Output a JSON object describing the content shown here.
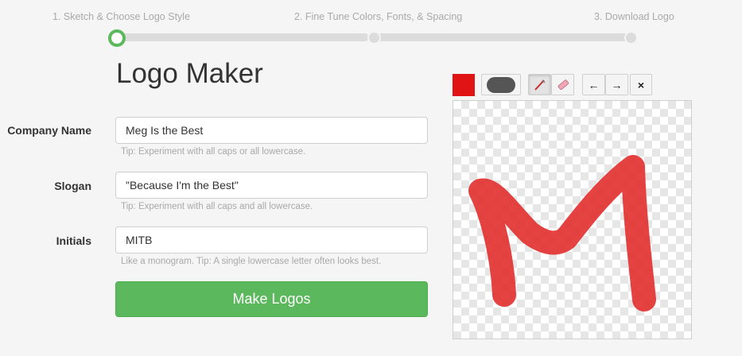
{
  "steps": [
    {
      "label": "1. Sketch & Choose Logo Style",
      "active": true
    },
    {
      "label": "2. Fine Tune Colors, Fonts, & Spacing",
      "active": false
    },
    {
      "label": "3. Download Logo",
      "active": false
    }
  ],
  "page_title": "Logo Maker",
  "form": {
    "company": {
      "label": "Company Name",
      "value": "Meg Is the Best",
      "tip": "Tip: Experiment with all caps or all lowercase."
    },
    "slogan": {
      "label": "Slogan",
      "value": "\"Because I'm the Best\"",
      "tip": "Tip: Experiment with all caps and all lowercase."
    },
    "initials": {
      "label": "Initials",
      "value": "MITB",
      "tip": "Like a monogram.  Tip: A single lowercase letter often looks best."
    },
    "submit_label": "Make Logos"
  },
  "toolbar": {
    "color": "#e01414",
    "undo_glyph": "←",
    "redo_glyph": "→",
    "clear_glyph": "×"
  },
  "colors": {
    "accent_green": "#5cb85c",
    "stroke_red": "#e22d2d"
  },
  "icons": [
    "brush-size-icon",
    "pencil-icon",
    "eraser-icon",
    "undo-arrow-icon",
    "redo-arrow-icon",
    "clear-icon"
  ]
}
